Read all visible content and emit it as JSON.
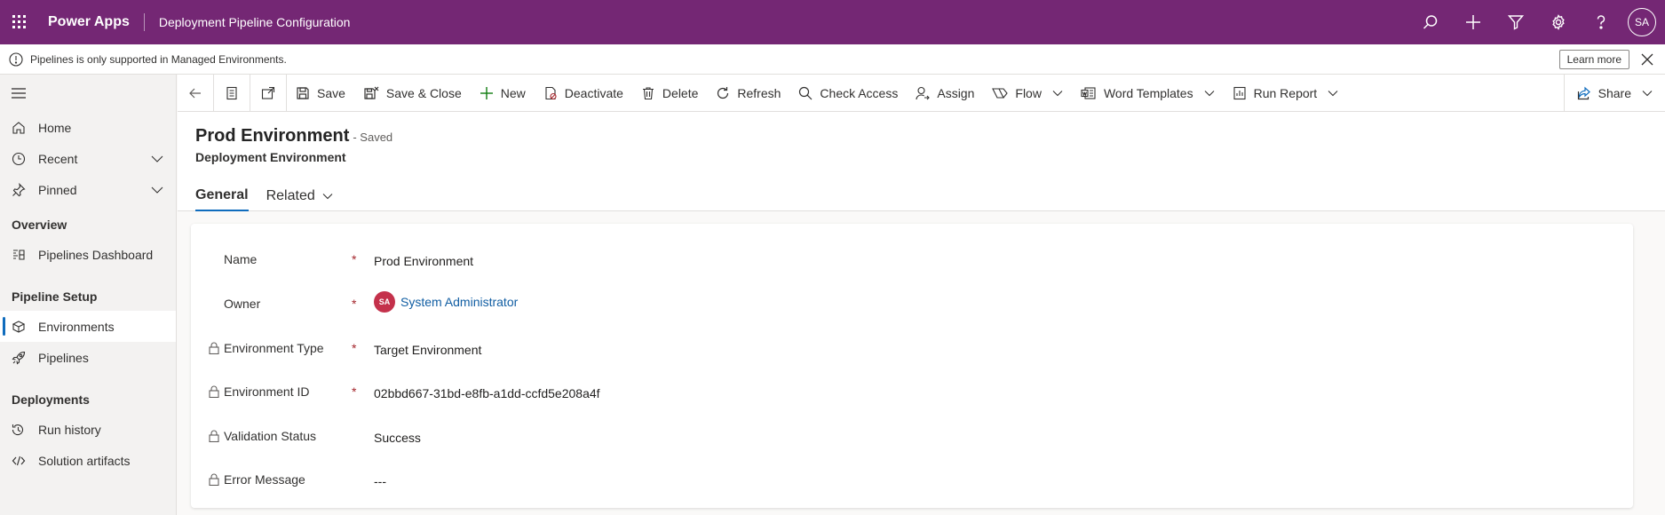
{
  "header": {
    "app_name": "Power Apps",
    "page_title": "Deployment Pipeline Configuration",
    "avatar_initials": "SA"
  },
  "notice": {
    "text": "Pipelines is only supported in Managed Environments.",
    "learn_more": "Learn more"
  },
  "sidebar": {
    "items": [
      {
        "label": "Home",
        "icon": "home-icon"
      },
      {
        "label": "Recent",
        "icon": "clock-icon"
      },
      {
        "label": "Pinned",
        "icon": "pin-icon"
      }
    ],
    "groups": [
      {
        "title": "Overview",
        "items": [
          {
            "label": "Pipelines Dashboard",
            "icon": "dashboard-icon"
          }
        ]
      },
      {
        "title": "Pipeline Setup",
        "items": [
          {
            "label": "Environments",
            "icon": "environment-icon",
            "active": true
          },
          {
            "label": "Pipelines",
            "icon": "rocket-icon"
          }
        ]
      },
      {
        "title": "Deployments",
        "items": [
          {
            "label": "Run history",
            "icon": "history-icon"
          },
          {
            "label": "Solution artifacts",
            "icon": "code-icon"
          }
        ]
      }
    ]
  },
  "commands": {
    "save": "Save",
    "save_close": "Save & Close",
    "new": "New",
    "deactivate": "Deactivate",
    "delete": "Delete",
    "refresh": "Refresh",
    "check_access": "Check Access",
    "assign": "Assign",
    "flow": "Flow",
    "word_templates": "Word Templates",
    "run_report": "Run Report",
    "share": "Share"
  },
  "record": {
    "title": "Prod Environment",
    "save_state": "- Saved",
    "entity": "Deployment Environment"
  },
  "tabs": {
    "general": "General",
    "related": "Related"
  },
  "fields": [
    {
      "label": "Name",
      "value": "Prod Environment",
      "required": true,
      "locked": false
    },
    {
      "label": "Owner",
      "value": "System Administrator",
      "required": true,
      "locked": false,
      "avatar": "SA"
    },
    {
      "label": "Environment Type",
      "value": "Target Environment",
      "required": true,
      "locked": true
    },
    {
      "label": "Environment ID",
      "value": "02bbd667-31bd-e8fb-a1dd-ccfd5e208a4f",
      "required": true,
      "locked": true
    },
    {
      "label": "Validation Status",
      "value": "Success",
      "required": false,
      "locked": true
    },
    {
      "label": "Error Message",
      "value": "---",
      "required": false,
      "locked": true
    }
  ],
  "colors": {
    "header_bg": "#742774",
    "accent": "#0f6cbd",
    "required": "#a4262c",
    "owner_avatar": "#c4314b",
    "link": "#115ea3"
  }
}
